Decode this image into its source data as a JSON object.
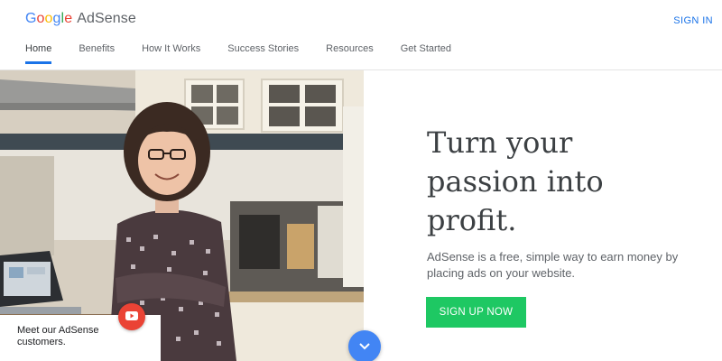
{
  "header": {
    "brand_letters": [
      "G",
      "o",
      "o",
      "g",
      "l",
      "e"
    ],
    "product": "AdSense",
    "signin": "SIGN IN"
  },
  "nav": {
    "items": [
      {
        "label": "Home",
        "active": true
      },
      {
        "label": "Benefits"
      },
      {
        "label": "How It Works"
      },
      {
        "label": "Success Stories"
      },
      {
        "label": "Resources"
      },
      {
        "label": "Get Started"
      }
    ]
  },
  "hero": {
    "headline_lines": [
      "Turn your",
      "passion into",
      "profit."
    ],
    "subtext": "AdSense is a free, simple way to earn money by placing ads on your website.",
    "cta": "SIGN UP NOW",
    "caption": "Meet our AdSense customers."
  },
  "icons": {
    "play": "youtube-play-icon",
    "scroll": "chevron-down-icon"
  },
  "colors": {
    "accent": "#1a73e8",
    "cta": "#1ec863",
    "play": "#ea4335",
    "scroll": "#4285f4"
  }
}
